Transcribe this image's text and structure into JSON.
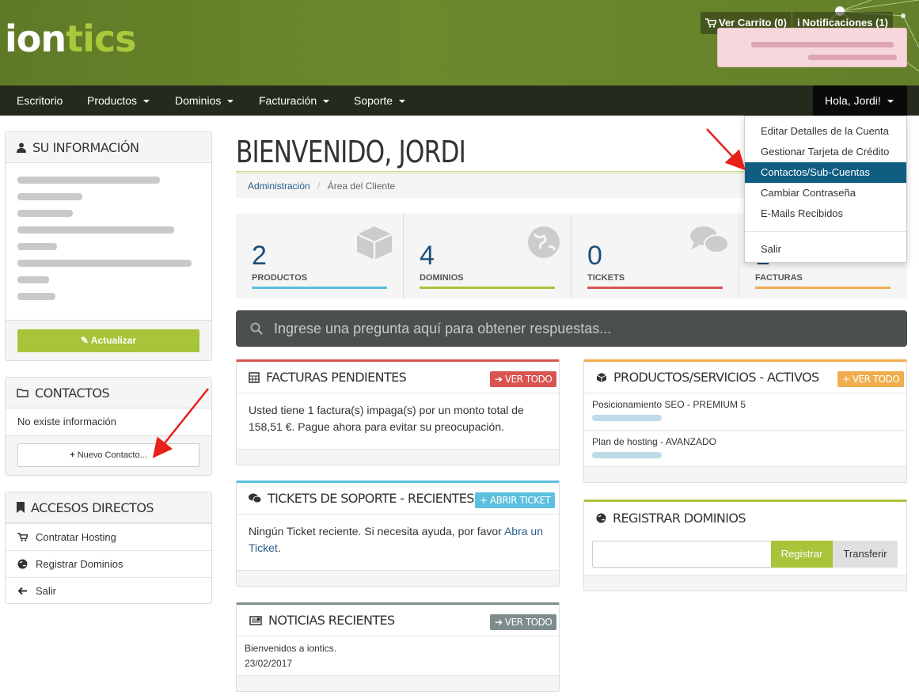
{
  "header": {
    "logo_a": "ion",
    "logo_b": "tics",
    "cart_label": "Ver Carrito (0)",
    "notifications_label": "Notificaciones (1)"
  },
  "nav": {
    "items": [
      "Escritorio",
      "Productos",
      "Dominios",
      "Facturación",
      "Soporte"
    ],
    "user_greeting": "Hola, Jordi!"
  },
  "user_menu": {
    "items": [
      "Editar Detalles de la Cuenta",
      "Gestionar Tarjeta de Crédito",
      "Contactos/Sub-Cuentas",
      "Cambiar Contraseña",
      "E-Mails Recibidos",
      "Salir"
    ],
    "active_index": 2
  },
  "sidebar": {
    "info_title": "SU INFORMACIÓN",
    "update_button": "Actualizar",
    "contacts_title": "CONTACTOS",
    "contacts_empty": "No existe información",
    "new_contact_button": "Nuevo Contacto...",
    "shortcuts_title": "ACCESOS DIRECTOS",
    "shortcuts": [
      "Contratar Hosting",
      "Registrar Dominios",
      "Salir"
    ]
  },
  "main": {
    "title": "BIENVENIDO, JORDI",
    "breadcrumb": [
      "Administración",
      "Área del Cliente"
    ],
    "stats": [
      {
        "value": "2",
        "label": "PRODUCTOS",
        "color": "#5bc0de"
      },
      {
        "value": "4",
        "label": "DOMINIOS",
        "color": "#a8c43a"
      },
      {
        "value": "0",
        "label": "TICKETS",
        "color": "#d9534f"
      },
      {
        "value": "1",
        "label": "FACTURAS",
        "color": "#f0ad4e"
      }
    ],
    "search_placeholder": "Ingrese una pregunta aquí para obtener respuestas..."
  },
  "invoices": {
    "title": "FACTURAS PENDIENTES",
    "button": "VER TODO",
    "text": "Usted tiene 1 factura(s) impaga(s) por un monto total de 158,51 €. Pague ahora para evitar su preocupación."
  },
  "tickets": {
    "title": "TICKETS DE SOPORTE - RECIENTES",
    "button": "ABRIR TICKET",
    "text": "Ningún Ticket reciente. Si necesita ayuda, por favor ",
    "link": "Abra un Ticket",
    "after": "."
  },
  "news": {
    "title": "NOTICIAS RECIENTES",
    "button": "VER TODO",
    "item": "Bienvenidos a iontics.",
    "date": "23/02/2017"
  },
  "products": {
    "title": "PRODUCTOS/SERVICIOS - ACTIVOS",
    "button": "VER TODO",
    "items": [
      "Posicionamiento SEO - PREMIUM 5",
      "Plan de hosting - AVANZADO"
    ]
  },
  "domains": {
    "title": "REGISTRAR DOMINIOS",
    "register_button": "Registrar",
    "transfer_button": "Transferir"
  }
}
